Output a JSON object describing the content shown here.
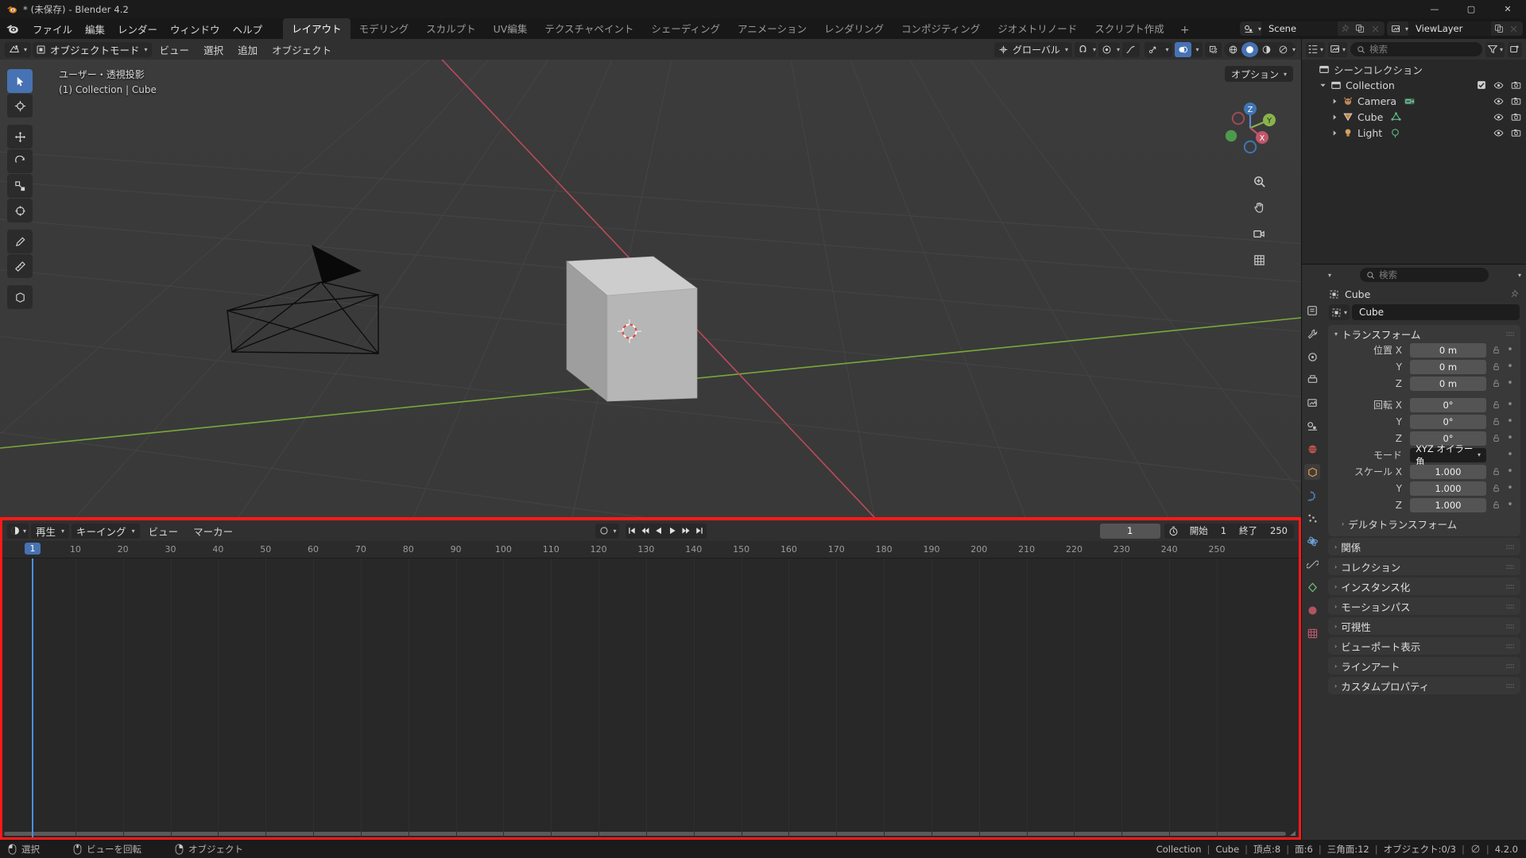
{
  "window": {
    "title": "* (未保存) - Blender 4.2",
    "controls": {
      "minimize": "—",
      "maximize": "▢",
      "close": "✕"
    }
  },
  "topbar": {
    "menus": [
      "ファイル",
      "編集",
      "レンダー",
      "ウィンドウ",
      "ヘルプ"
    ],
    "workspaces": [
      {
        "label": "レイアウト",
        "active": true
      },
      {
        "label": "モデリング",
        "active": false
      },
      {
        "label": "スカルプト",
        "active": false
      },
      {
        "label": "UV編集",
        "active": false
      },
      {
        "label": "テクスチャペイント",
        "active": false
      },
      {
        "label": "シェーディング",
        "active": false
      },
      {
        "label": "アニメーション",
        "active": false
      },
      {
        "label": "レンダリング",
        "active": false
      },
      {
        "label": "コンポジティング",
        "active": false
      },
      {
        "label": "ジオメトリノード",
        "active": false
      },
      {
        "label": "スクリプト作成",
        "active": false
      }
    ],
    "add_workspace": "+",
    "scene_name": "Scene",
    "viewlayer_name": "ViewLayer"
  },
  "viewport": {
    "mode": "オブジェクトモード",
    "menus": [
      "ビュー",
      "選択",
      "追加",
      "オブジェクト"
    ],
    "transform_orientation": "グローバル",
    "options_label": "オプション",
    "overlay_line1": "ユーザー・透視投影",
    "overlay_line2": "(1) Collection | Cube",
    "gizmo_axes": {
      "x": "X",
      "y": "Y",
      "z": "Z"
    }
  },
  "timeline": {
    "menus": [
      "ビュー",
      "マーカー"
    ],
    "playback_label": "再生",
    "keying_label": "キーイング",
    "current_frame": "1",
    "start_label": "開始",
    "start_value": "1",
    "end_label": "終了",
    "end_value": "250",
    "ticks": [
      "1",
      "10",
      "20",
      "30",
      "40",
      "50",
      "60",
      "70",
      "80",
      "90",
      "100",
      "110",
      "120",
      "130",
      "140",
      "150",
      "160",
      "170",
      "180",
      "190",
      "200",
      "210",
      "220",
      "230",
      "240",
      "250"
    ],
    "playhead_frame": "1",
    "highlight_color": "#ff1a1a"
  },
  "outliner": {
    "search_placeholder": "検索",
    "rows": [
      {
        "label": "シーンコレクション",
        "depth": 0,
        "icon": "collection-icon",
        "arrow": "",
        "data_icon": "",
        "checkbox": false,
        "eye": false,
        "camera": false
      },
      {
        "label": "Collection",
        "depth": 1,
        "icon": "collection-icon",
        "arrow": "down",
        "data_icon": "",
        "checkbox": true,
        "eye": true,
        "camera": true
      },
      {
        "label": "Camera",
        "depth": 2,
        "icon": "camera-object-icon",
        "arrow": "right",
        "data_icon": "camera-data-icon",
        "checkbox": false,
        "eye": true,
        "camera": true
      },
      {
        "label": "Cube",
        "depth": 2,
        "icon": "mesh-object-icon",
        "arrow": "right",
        "data_icon": "mesh-data-icon",
        "checkbox": false,
        "eye": true,
        "camera": true
      },
      {
        "label": "Light",
        "depth": 2,
        "icon": "light-object-icon",
        "arrow": "right",
        "data_icon": "light-data-icon",
        "checkbox": false,
        "eye": true,
        "camera": true
      }
    ]
  },
  "properties": {
    "search_placeholder": "検索",
    "breadcrumb": "Cube",
    "id_name": "Cube",
    "transform": {
      "title": "トランスフォーム",
      "location_label": "位置 X",
      "location": [
        {
          "axis": "位置 X",
          "value": "0 m"
        },
        {
          "axis": "Y",
          "value": "0 m"
        },
        {
          "axis": "Z",
          "value": "0 m"
        }
      ],
      "rotation": [
        {
          "axis": "回転 X",
          "value": "0°"
        },
        {
          "axis": "Y",
          "value": "0°"
        },
        {
          "axis": "Z",
          "value": "0°"
        }
      ],
      "mode_label": "モード",
      "mode_value": "XYZ オイラー角",
      "scale": [
        {
          "axis": "スケール X",
          "value": "1.000"
        },
        {
          "axis": "Y",
          "value": "1.000"
        },
        {
          "axis": "Z",
          "value": "1.000"
        }
      ],
      "delta_transform": "デルタトランスフォーム"
    },
    "panels": [
      "関係",
      "コレクション",
      "インスタンス化",
      "モーションパス",
      "可視性",
      "ビューポート表示",
      "ラインアート",
      "カスタムプロパティ"
    ]
  },
  "statusbar": {
    "hints": [
      {
        "icon": "mouse-left-icon",
        "label": "選択"
      },
      {
        "icon": "mouse-middle-icon",
        "label": "ビューを回転"
      },
      {
        "icon": "mouse-right-icon",
        "label": "オブジェクト"
      }
    ],
    "scene_stats": {
      "collection": "Collection",
      "object": "Cube",
      "verts": "頂点:8",
      "faces": "面:6",
      "tris": "三角面:12",
      "objects": "オブジェクト:0/3",
      "version": "4.2.0"
    },
    "separator": "|"
  }
}
